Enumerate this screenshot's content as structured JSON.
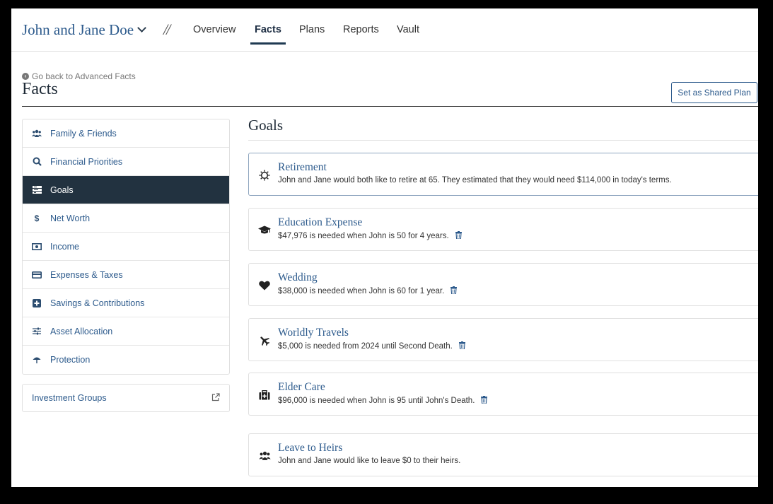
{
  "nav": {
    "client_name": "John and Jane Doe",
    "separator": "//",
    "tabs": [
      {
        "label": "Overview"
      },
      {
        "label": "Facts"
      },
      {
        "label": "Plans"
      },
      {
        "label": "Reports"
      },
      {
        "label": "Vault"
      }
    ],
    "active_tab": "Facts"
  },
  "header": {
    "back_link": "Go back to Advanced Facts",
    "title": "Facts",
    "shared_button": "Set as Shared Plan"
  },
  "sidebar": {
    "items": [
      {
        "label": "Family & Friends",
        "icon": "family-icon"
      },
      {
        "label": "Financial Priorities",
        "icon": "search-icon"
      },
      {
        "label": "Goals",
        "icon": "goals-icon",
        "active": true
      },
      {
        "label": "Net Worth",
        "icon": "dollar-icon"
      },
      {
        "label": "Income",
        "icon": "cash-icon"
      },
      {
        "label": "Expenses & Taxes",
        "icon": "credit-card-icon"
      },
      {
        "label": "Savings & Contributions",
        "icon": "plus-square-icon"
      },
      {
        "label": "Asset Allocation",
        "icon": "sliders-icon"
      },
      {
        "label": "Protection",
        "icon": "umbrella-icon"
      }
    ],
    "investment_groups": "Investment Groups"
  },
  "goals": {
    "heading": "Goals",
    "items": [
      {
        "title": "Retirement",
        "desc": "John and Jane would both like to retire at 65. They estimated that they would need $114,000 in today's terms.",
        "icon": "sun-icon",
        "deletable": false
      },
      {
        "title": "Education Expense",
        "desc": "$47,976 is needed when John is 50 for 4 years.",
        "icon": "graduation-cap-icon",
        "deletable": true
      },
      {
        "title": "Wedding",
        "desc": "$38,000 is needed when John is 60 for 1 year.",
        "icon": "heart-icon",
        "deletable": true
      },
      {
        "title": "Worldly Travels",
        "desc": "$5,000 is needed from 2024 until Second Death.",
        "icon": "plane-icon",
        "deletable": true
      },
      {
        "title": "Elder Care",
        "desc": "$96,000 is needed when John is 95 until John's Death.",
        "icon": "medical-kit-icon",
        "deletable": true
      },
      {
        "title": "Leave to Heirs",
        "desc": "John and Jane would like to leave $0 to their heirs.",
        "icon": "family-icon",
        "deletable": false
      }
    ]
  },
  "colors": {
    "brand_blue": "#2c5a8c",
    "active_nav_bg": "#223240"
  }
}
